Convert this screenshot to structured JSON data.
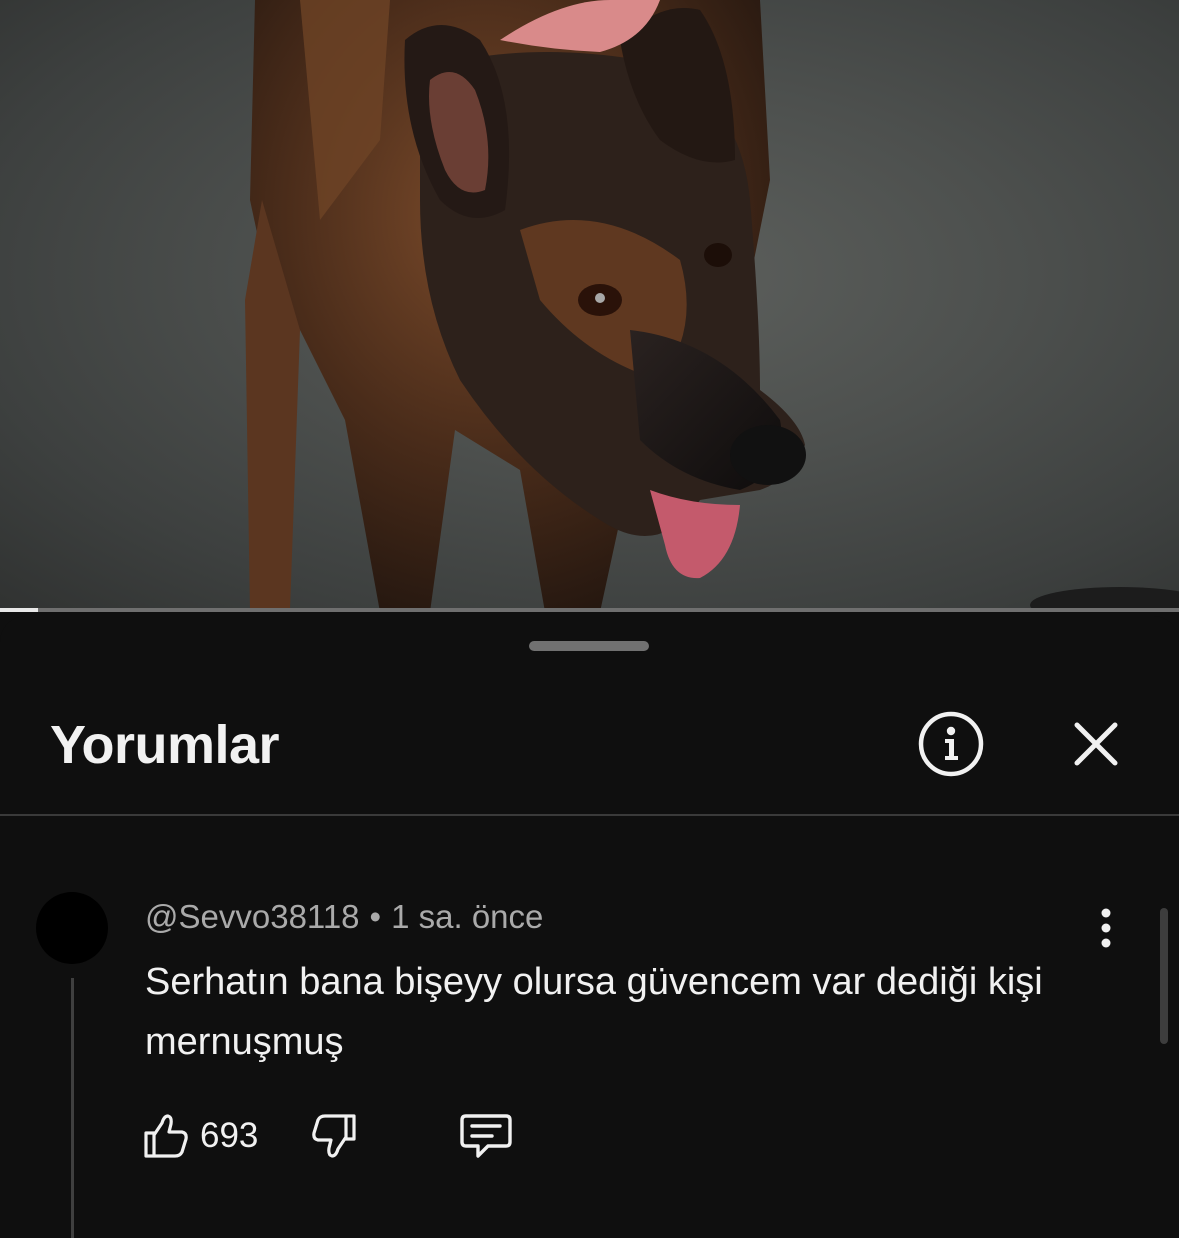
{
  "video": {
    "progress_fraction": 0.032,
    "scene": "dog-still-frame"
  },
  "panel": {
    "title": "Yorumlar",
    "info_icon": "info-circle-icon",
    "close_icon": "close-icon"
  },
  "comment": {
    "author": "@Sevvo38118",
    "separator": "•",
    "time": "1 sa. önce",
    "text": "Serhatın bana bişeyy olursa güvencem var dediği kişi mernuşmuş",
    "likes": "693",
    "icons": {
      "like": "thumbs-up-icon",
      "dislike": "thumbs-down-icon",
      "reply": "comment-icon",
      "more": "more-vertical-icon"
    }
  },
  "colors": {
    "background": "#0f0f0f",
    "text_primary": "#f1f1f1",
    "text_secondary": "#aaaaaa",
    "divider": "#3a3a3a"
  }
}
